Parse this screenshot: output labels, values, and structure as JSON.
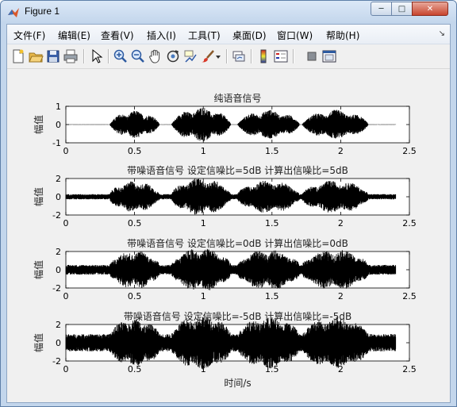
{
  "window": {
    "title": "Figure 1"
  },
  "controls": {
    "minimize": "─",
    "maximize": "□",
    "close": "✕"
  },
  "menu": {
    "items": [
      "文件(F)",
      "编辑(E)",
      "查看(V)",
      "插入(I)",
      "工具(T)",
      "桌面(D)",
      "窗口(W)",
      "帮助(H)"
    ],
    "overflow": "↘"
  },
  "toolbar": {
    "icons": [
      "new-figure-icon",
      "open-file-icon",
      "save-icon",
      "print-icon",
      "pointer-icon",
      "zoom-in-icon",
      "zoom-out-icon",
      "pan-icon",
      "rotate-3d-icon",
      "data-cursor-icon",
      "brush-icon",
      "link-plot-icon",
      "colorbar-icon",
      "legend-icon",
      "hide-plot-tools-icon",
      "show-plot-tools-icon"
    ]
  },
  "figure": {
    "xlabel": "时间/s",
    "ylabel": "幅值",
    "axes_color": "#000000",
    "signal_color": "#000000"
  },
  "chart_data": [
    {
      "type": "line",
      "title": "纯语音信号",
      "ylabel": "幅值",
      "xlim": [
        0,
        2.5
      ],
      "ylim": [
        -1,
        1
      ],
      "xticks": [
        "0",
        "0.5",
        "1",
        "1.5",
        "2",
        "2.5"
      ],
      "yticks": [
        "1",
        "0",
        "-1"
      ],
      "signal_duration": 2.4,
      "noise_amplitude": 0.01,
      "segments": [
        {
          "start": 0.32,
          "end": 0.68,
          "amplitude": 0.8
        },
        {
          "start": 0.77,
          "end": 1.2,
          "amplitude": 1.0
        },
        {
          "start": 1.25,
          "end": 1.7,
          "amplitude": 0.85
        },
        {
          "start": 1.72,
          "end": 2.2,
          "amplitude": 0.85
        }
      ]
    },
    {
      "type": "line",
      "title": "带噪语音信号 设定信噪比=5dB  计算出信噪比=5dB",
      "ylabel": "幅值",
      "xlim": [
        0,
        2.5
      ],
      "ylim": [
        -2,
        2
      ],
      "xticks": [
        "0",
        "0.5",
        "1",
        "1.5",
        "2",
        "2.5"
      ],
      "yticks": [
        "2",
        "0",
        "-2"
      ],
      "signal_duration": 2.4,
      "noise_amplitude": 0.15,
      "segments": [
        {
          "start": 0.32,
          "end": 0.68,
          "amplitude": 0.75
        },
        {
          "start": 0.77,
          "end": 1.2,
          "amplitude": 0.95
        },
        {
          "start": 1.25,
          "end": 1.7,
          "amplitude": 0.8
        },
        {
          "start": 1.72,
          "end": 2.2,
          "amplitude": 0.8
        }
      ]
    },
    {
      "type": "line",
      "title": "带噪语音信号 设定信噪比=0dB  计算出信噪比=0dB",
      "ylabel": "幅值",
      "xlim": [
        0,
        2.5
      ],
      "ylim": [
        -2,
        2
      ],
      "xticks": [
        "0",
        "0.5",
        "1",
        "1.5",
        "2",
        "2.5"
      ],
      "yticks": [
        "2",
        "0",
        "-2"
      ],
      "signal_duration": 2.4,
      "noise_amplitude": 0.28,
      "segments": [
        {
          "start": 0.32,
          "end": 0.68,
          "amplitude": 0.85
        },
        {
          "start": 0.77,
          "end": 1.2,
          "amplitude": 1.0
        },
        {
          "start": 1.25,
          "end": 1.7,
          "amplitude": 0.9
        },
        {
          "start": 1.72,
          "end": 2.2,
          "amplitude": 0.9
        }
      ]
    },
    {
      "type": "line",
      "title": "带噪语音信号 设定信噪比=-5dB  计算出信噪比=-5dB",
      "ylabel": "幅值",
      "xlim": [
        0,
        2.5
      ],
      "ylim": [
        -2,
        2
      ],
      "xticks": [
        "0",
        "0.5",
        "1",
        "1.5",
        "2",
        "2.5"
      ],
      "yticks": [
        "2",
        "0",
        "-2"
      ],
      "xlabel": "时间/s",
      "signal_duration": 2.4,
      "noise_amplitude": 0.5,
      "segments": [
        {
          "start": 0.32,
          "end": 0.68,
          "amplitude": 0.9
        },
        {
          "start": 0.77,
          "end": 1.2,
          "amplitude": 1.1
        },
        {
          "start": 1.25,
          "end": 1.7,
          "amplitude": 1.0
        },
        {
          "start": 1.72,
          "end": 2.2,
          "amplitude": 1.0
        }
      ]
    }
  ]
}
